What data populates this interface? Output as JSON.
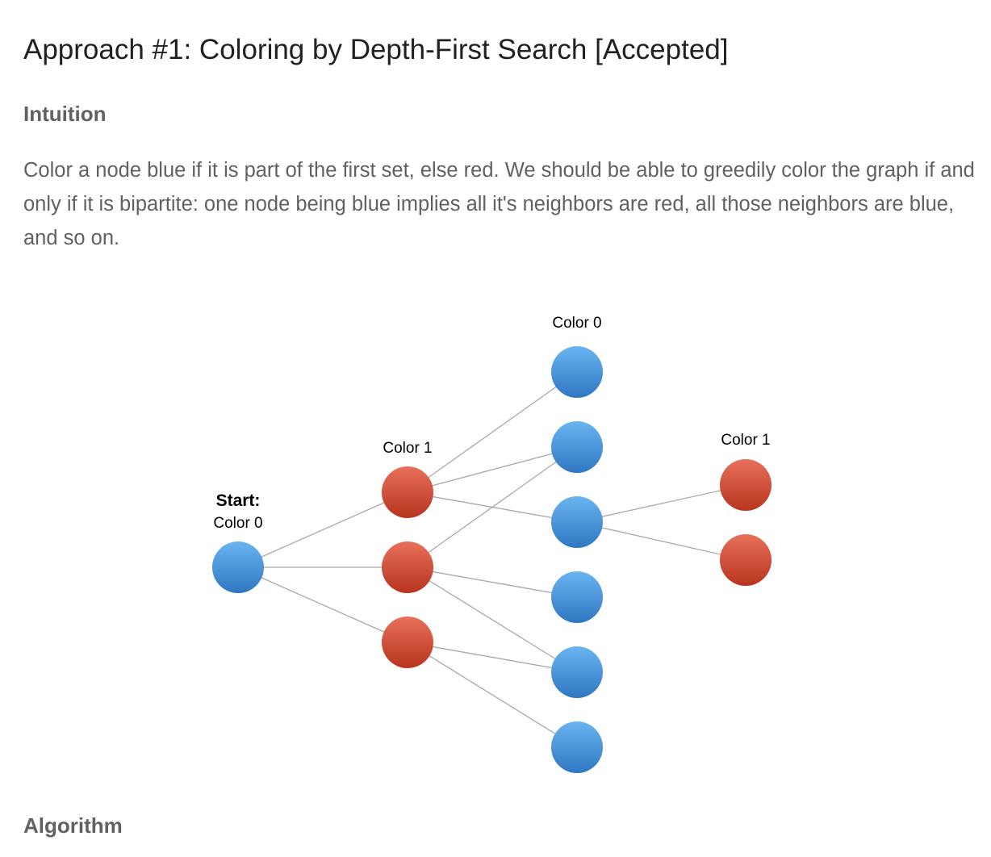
{
  "article": {
    "title": "Approach #1: Coloring by Depth-First Search [Accepted]",
    "intuition_heading": "Intuition",
    "intuition_paragraph": "Color a node blue if it is part of the first set, else red. We should be able to greedily color the graph if and only if it is bipartite: one node being blue implies all it's neighbors are red, all those neighbors are blue, and so on.",
    "algorithm_heading": "Algorithm"
  },
  "figure": {
    "start_label": "Start:",
    "labels": {
      "start_color": "Color 0",
      "col1_color": "Color 1",
      "col2_color": "Color 0",
      "col3_color": "Color 1"
    },
    "colors": {
      "blue_light": "#6ab4f0",
      "blue_dark": "#2f77c2",
      "red_light": "#e8705a",
      "red_dark": "#b8341f",
      "edge": "#a8a8a8"
    }
  }
}
